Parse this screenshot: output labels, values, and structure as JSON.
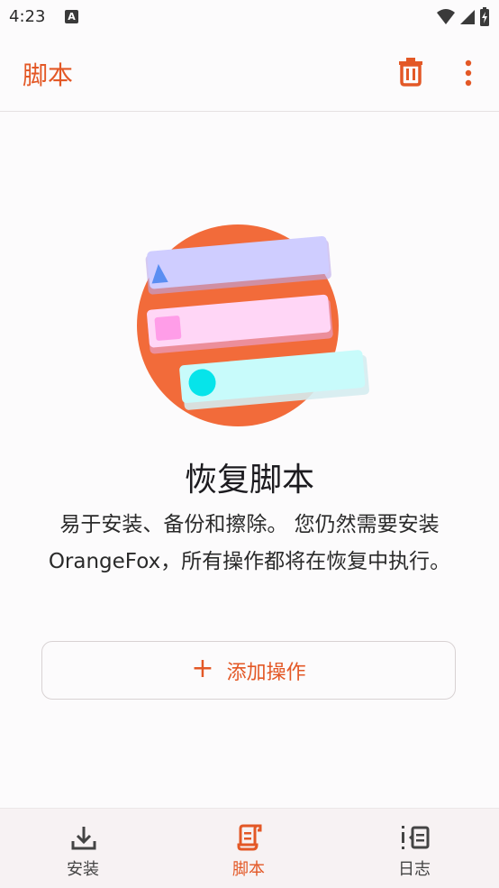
{
  "status": {
    "time": "4:23",
    "a_badge": "A"
  },
  "app_bar": {
    "title": "脚本"
  },
  "empty_state": {
    "title": "恢复脚本",
    "description": "易于安装、备份和擦除。 您仍然需要安装OrangeFox，所有操作都将在恢复中执行。"
  },
  "add_button": {
    "plus": "+",
    "label": "添加操作"
  },
  "bottom_nav": {
    "items": [
      {
        "label": "安装",
        "icon": "download-icon",
        "active": false
      },
      {
        "label": "脚本",
        "icon": "script-icon",
        "active": true
      },
      {
        "label": "日志",
        "icon": "log-icon",
        "active": false
      }
    ]
  },
  "colors": {
    "accent": "#e35826",
    "circle": "#f26b3a",
    "card_lavender": "#cfcdff",
    "card_pink": "#ffd6f6",
    "card_cyan": "#c8fbfb",
    "triangle": "#5a8ef2",
    "square": "#ff9de8",
    "dot": "#06e4ea"
  }
}
